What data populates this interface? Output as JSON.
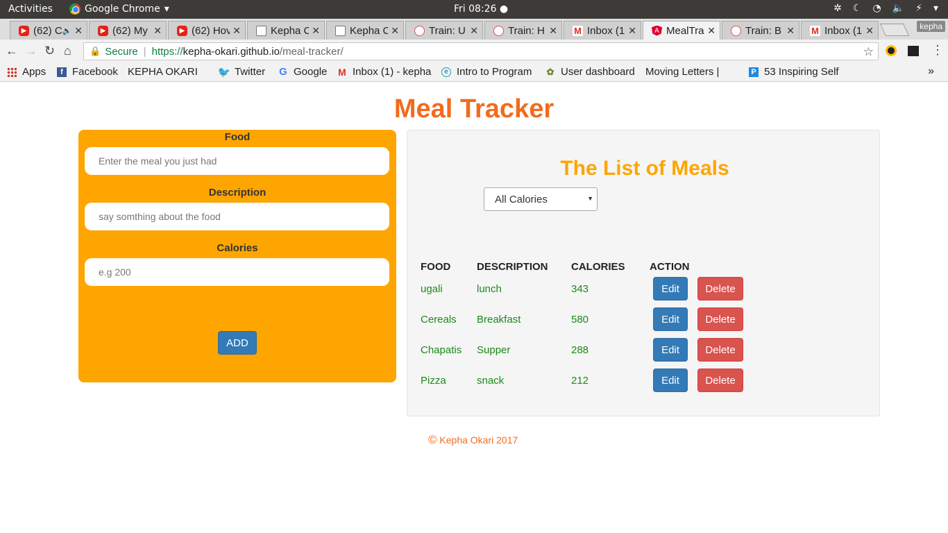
{
  "os_bar": {
    "activities": "Activities",
    "app_name": "Google Chrome",
    "app_menu_caret": "▾",
    "clock": "Fri 08:26 ●",
    "tray": [
      "✲",
      "☾",
      "◔",
      "🔈",
      "⚡",
      "▾"
    ]
  },
  "tabs": [
    {
      "favicon": "youtube-icon",
      "title": "(62) C",
      "extra": "🔈",
      "active": false
    },
    {
      "favicon": "youtube-icon",
      "title": "(62) My",
      "active": false
    },
    {
      "favicon": "youtube-icon",
      "title": "(62) Hov",
      "active": false
    },
    {
      "favicon": "page-icon",
      "title": "Kepha C",
      "active": false
    },
    {
      "favicon": "page-icon",
      "title": "Kepha C",
      "active": false
    },
    {
      "favicon": "train-icon",
      "title": "Train: U",
      "active": false
    },
    {
      "favicon": "train-icon",
      "title": "Train: H",
      "active": false
    },
    {
      "favicon": "gmail-icon",
      "title": "Inbox (1",
      "active": false
    },
    {
      "favicon": "angular-icon",
      "title": "MealTra",
      "active": true
    },
    {
      "favicon": "train-icon",
      "title": "Train: B",
      "active": false
    },
    {
      "favicon": "gmail-icon",
      "title": "Inbox (1",
      "active": false
    }
  ],
  "profile_name": "kepha",
  "address": {
    "secure_label": "Secure",
    "scheme": "https://",
    "host": "kepha-okari.github.io",
    "path": "/meal-tracker/"
  },
  "bookmarks": [
    {
      "icon": "apps-icon",
      "label": "Apps"
    },
    {
      "icon": "facebook-icon",
      "label": "Facebook"
    },
    {
      "icon": "page-icon",
      "label": "KEPHA OKARI"
    },
    {
      "icon": "twitter-icon",
      "label": "Twitter"
    },
    {
      "icon": "google-icon",
      "label": "Google"
    },
    {
      "icon": "gmail-icon",
      "label": "Inbox (1) - kepha"
    },
    {
      "icon": "e-icon",
      "label": "Intro to Program"
    },
    {
      "icon": "user-dashboard-icon",
      "label": "User dashboard"
    },
    {
      "icon": "page-icon",
      "label": "Moving Letters |"
    },
    {
      "icon": "p-icon",
      "label": "53 Inspiring Self"
    }
  ],
  "bookmarks_more": "»",
  "page": {
    "title": "Meal Tracker",
    "form": {
      "food_label": "Food",
      "food_placeholder": "Enter the meal you just had",
      "description_label": "Description",
      "description_placeholder": "say somthing about the food",
      "calories_label": "Calories",
      "calories_placeholder": "e.g 200",
      "add_label": "ADD"
    },
    "list": {
      "title": "The List of Meals",
      "filter_value": "All Calories",
      "headers": {
        "food": "FOOD",
        "description": "DESCRIPTION",
        "calories": "CALORIES",
        "action": "ACTION"
      },
      "edit_label": "Edit",
      "delete_label": "Delete",
      "meals": [
        {
          "food": "ugali",
          "description": "lunch",
          "calories": "343"
        },
        {
          "food": "Cereals",
          "description": "Breakfast",
          "calories": "580"
        },
        {
          "food": "Chapatis",
          "description": "Supper",
          "calories": "288"
        },
        {
          "food": "Pizza",
          "description": "snack",
          "calories": "212"
        }
      ]
    },
    "footer": {
      "copyright_symbol": "©",
      "text": "Kepha Okari 2017"
    }
  },
  "colors": {
    "title_orange": "#f26b1d",
    "panel_orange": "#ffa500",
    "meal_text_green": "#1a8a1a",
    "edit_blue": "#337ab7",
    "delete_red": "#d9534f"
  }
}
